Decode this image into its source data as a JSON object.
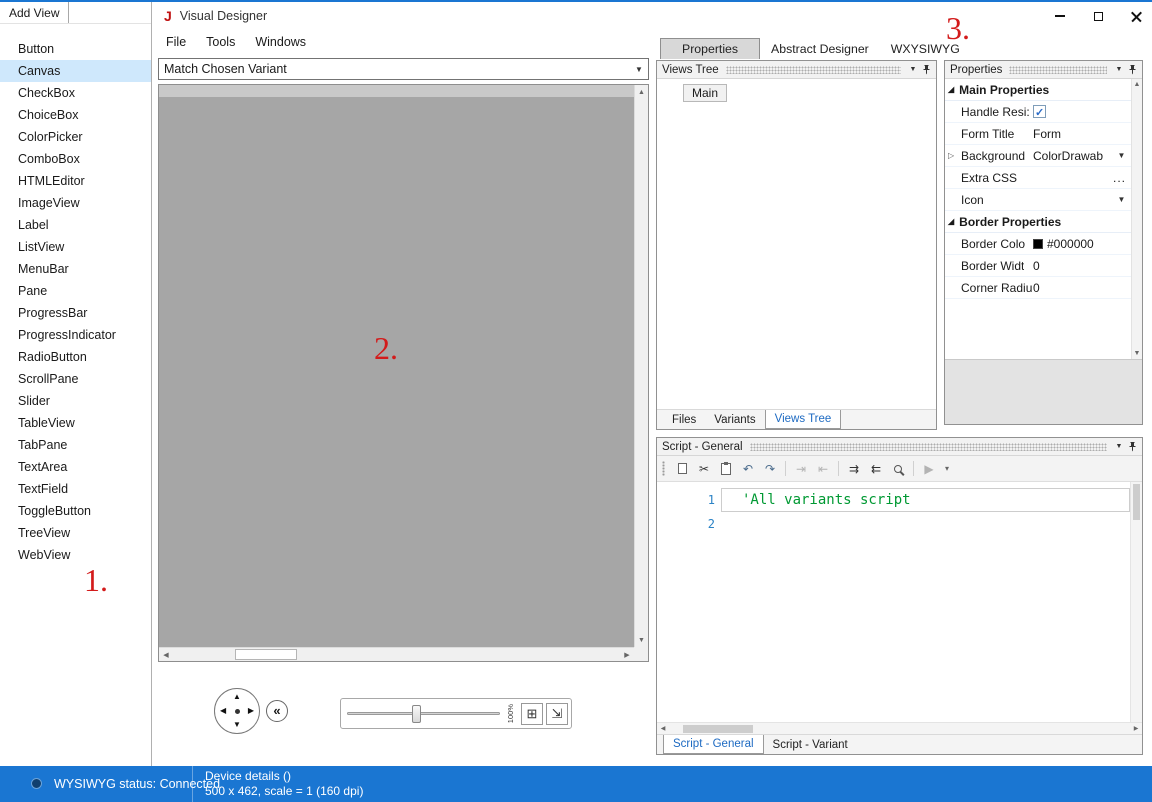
{
  "colors": {
    "accent": "#1a76d2",
    "comment": "#009933",
    "line-number": "#2b83c6",
    "annotation": "#d31b1b",
    "selection": "#cfe8fc"
  },
  "annotations": {
    "n1": "1.",
    "n2": "2.",
    "n3": "3."
  },
  "palette": {
    "title": "Add View",
    "selected_item": "Canvas",
    "items": [
      "Button",
      "Canvas",
      "CheckBox",
      "ChoiceBox",
      "ColorPicker",
      "ComboBox",
      "HTMLEditor",
      "ImageView",
      "Label",
      "ListView",
      "MenuBar",
      "Pane",
      "ProgressBar",
      "ProgressIndicator",
      "RadioButton",
      "ScrollPane",
      "Slider",
      "TableView",
      "TabPane",
      "TextArea",
      "TextField",
      "ToggleButton",
      "TreeView",
      "WebView"
    ]
  },
  "titlebar": {
    "logo": "J",
    "title": "Visual Designer"
  },
  "menubar": {
    "items": [
      "File",
      "Tools",
      "Windows"
    ]
  },
  "designer": {
    "variant_selector_value": "Match Chosen Variant",
    "zoom_label": "100%"
  },
  "nav": {
    "up": "▲",
    "down": "▼",
    "left": "◀",
    "right": "▶",
    "collapse": "«",
    "grid_glyph": "⊞",
    "fit_glyph": "⇲"
  },
  "dock_tabs": {
    "properties": "Properties",
    "abstract_designer": "Abstract Designer",
    "wysiwyg": "WXYSIWYG"
  },
  "views_tree": {
    "header": "Views Tree",
    "root_node": "Main",
    "tabs": [
      "Files",
      "Variants",
      "Views Tree"
    ],
    "active_tab": "Views Tree"
  },
  "properties": {
    "header": "Properties",
    "group_main": "Main Properties",
    "group_border": "Border Properties",
    "rows": {
      "handle_resize": {
        "label": "Handle Resi:",
        "checked": true
      },
      "form_title": {
        "label": "Form Title",
        "value": "Form"
      },
      "background": {
        "label": "Background",
        "value": "ColorDrawab"
      },
      "extra_css": {
        "label": "Extra CSS",
        "value": "..."
      },
      "icon": {
        "label": "Icon"
      },
      "border_color": {
        "label": "Border Colo",
        "value": "#000000",
        "swatch": "#000000"
      },
      "border_width": {
        "label": "Border Widt",
        "value": "0"
      },
      "corner_radius": {
        "label": "Corner Radiu",
        "value": "0"
      }
    }
  },
  "script_panel": {
    "header": "Script - General",
    "toolbar_glyphs": {
      "cut": "✂",
      "undo": "↶",
      "redo": "↷",
      "indent": "⇥",
      "outdent": "⇤",
      "comment": "⇉",
      "uncomment": "⇇",
      "run": "▶",
      "more": "▾"
    },
    "toolbar_icons": [
      "copy",
      "cut",
      "paste",
      "undo",
      "redo",
      "indent",
      "outdent",
      "comment",
      "uncomment",
      "search",
      "run",
      "overflow"
    ],
    "lines": [
      {
        "num": "1",
        "code": "'All variants script"
      },
      {
        "num": "2",
        "code": ""
      }
    ],
    "tabs": [
      "Script - General",
      "Script - Variant"
    ],
    "active_tab": "Script - General"
  },
  "statusbar": {
    "wysiwyg_status": "WYSIWYG status: Connected",
    "device_line1": "Device details ()",
    "device_line2": "500 x 462, scale = 1 (160 dpi)"
  }
}
